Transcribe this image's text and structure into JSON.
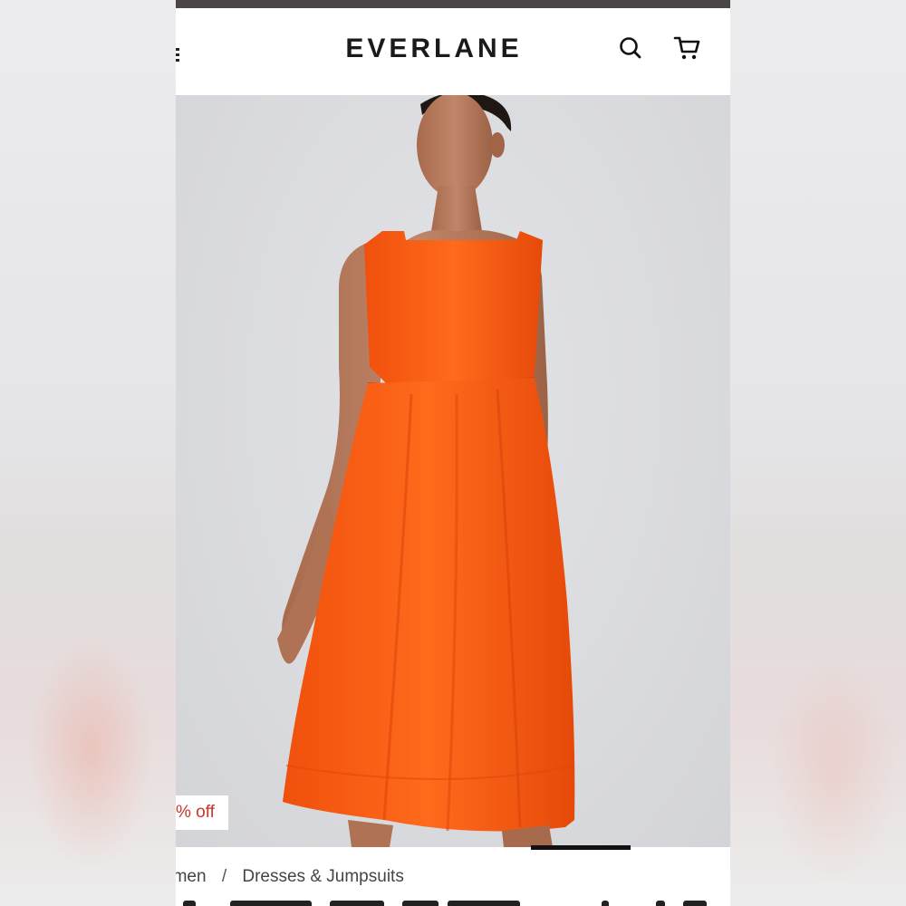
{
  "header": {
    "brand": "EVERLANE",
    "icons": [
      "menu-icon",
      "search-icon",
      "cart-icon"
    ]
  },
  "product_image": {
    "alt_subject": "model-wearing-orange-sleeveless-midi-dress",
    "colors": {
      "dress": "#ff5a12",
      "background": "#d9dadd",
      "skin": "#b5775a",
      "hair": "#1e1714"
    }
  },
  "badge": {
    "discount_text": "% off",
    "discount_color": "#c4372b"
  },
  "breadcrumb": {
    "items": [
      "omen",
      "Dresses & Jumpsuits"
    ],
    "separator": "/"
  },
  "colors": {
    "topbar": "#4a4645",
    "text": "#1a1a1a"
  }
}
